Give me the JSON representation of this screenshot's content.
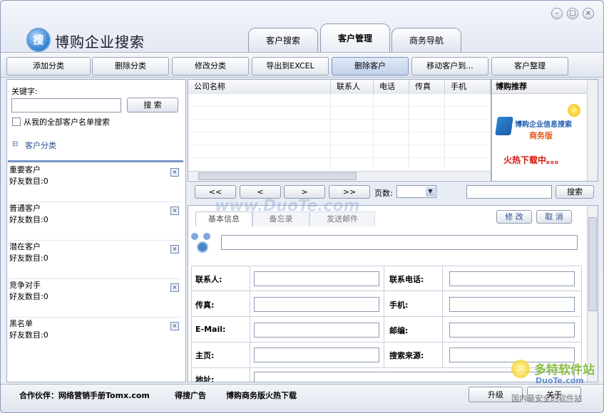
{
  "app": {
    "title": "博购企业搜索",
    "logo_glyph": "搜"
  },
  "window_controls": {
    "minimize": "–",
    "maximize": "□",
    "close": "×"
  },
  "tabs": [
    {
      "label": "客户搜索",
      "active": false
    },
    {
      "label": "客户管理",
      "active": true
    },
    {
      "label": "商务导航",
      "active": false
    }
  ],
  "toolbar": {
    "add_category": "添加分类",
    "delete_category": "删除分类",
    "edit_category": "修改分类",
    "export_excel": "导出到EXCEL",
    "delete_customer": "删除客户",
    "move_customer": "移动客户到...",
    "organize_customer": "客户整理"
  },
  "left": {
    "keyword_label": "关键字:",
    "keyword_value": "",
    "search_button": "搜 索",
    "search_all_label": "从我的全部客户名单搜索",
    "search_all_checked": false,
    "category_tree_label": "客户分类",
    "tree_toggle": "⊟",
    "categories": [
      {
        "name": "重要客户",
        "count": "好友数目:0"
      },
      {
        "name": "普通客户",
        "count": "好友数目:0"
      },
      {
        "name": "潜在客户",
        "count": "好友数目:0"
      },
      {
        "name": "竞争对手",
        "count": "好友数目:0"
      },
      {
        "name": "黑名单",
        "count": "好友数目:0"
      }
    ],
    "remove_glyph": "×"
  },
  "grid": {
    "columns": [
      "公司名称",
      "联系人",
      "电话",
      "传真",
      "手机"
    ],
    "rows": []
  },
  "ad": {
    "header": "博购推荐",
    "title": "博购企业信息搜索",
    "edition": "商务版",
    "tagline": "火热下载中。。。"
  },
  "pager": {
    "first": "<<",
    "prev": "<",
    "next": ">",
    "last": ">>",
    "page_label": "页数:",
    "page_value": "",
    "search_value": "",
    "search_button": "搜索"
  },
  "detail": {
    "tabs": [
      "基本信息",
      "备忘录",
      "发送邮件"
    ],
    "edit_button": "修 改",
    "cancel_button": "取 消",
    "company_value": "",
    "fields": [
      {
        "label": "联系人:",
        "value": ""
      },
      {
        "label": "联系电话:",
        "value": ""
      },
      {
        "label": "传真:",
        "value": ""
      },
      {
        "label": "手机:",
        "value": ""
      },
      {
        "label": "E-Mail:",
        "value": ""
      },
      {
        "label": "邮编:",
        "value": ""
      },
      {
        "label": "主页:",
        "value": ""
      },
      {
        "label": "搜索来源:",
        "value": ""
      },
      {
        "label": "地址:",
        "value": ""
      }
    ]
  },
  "status_bar": {
    "partner_label": "合作伙伴：网络营销手册Tomx.com",
    "link_ads": "得搜广告",
    "link_download": "博购商务版火热下载",
    "upgrade_button": "升级",
    "about_button": "关于"
  },
  "watermarks": {
    "center": "www.DuoTe.com",
    "corner_brand": "多特软件站",
    "corner_url": "DuoTe.com",
    "corner_slogan": "国内最安全的软件站"
  },
  "colors": {
    "accent": "#2f7dd0",
    "ad_red": "#d4140b",
    "ad_orange": "#e2591a",
    "selected_button": "#c3d3ec"
  },
  "icons": {
    "node": "network-node-icon"
  }
}
